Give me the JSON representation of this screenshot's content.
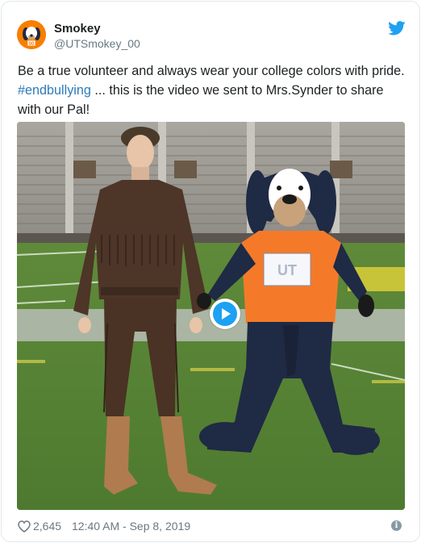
{
  "author": {
    "name": "Smokey",
    "handle": "@UTSmokey_00",
    "avatar_icon": "smokey-dog-icon",
    "avatar_color": "#f77f00"
  },
  "tweet": {
    "line1": "Be a true volunteer and always wear your college colors with pride.",
    "hashtag": "#endbullying",
    "line2_rest": " ... this is the video we sent to Mrs.Synder to share",
    "line3": "with our Pal!"
  },
  "media": {
    "type": "video",
    "play_icon": "play-icon",
    "sign_text": "UT"
  },
  "footer": {
    "likes": "2,645",
    "timestamp": "12:40 AM - Sep 8, 2019",
    "info_icon": "i"
  },
  "colors": {
    "twitter_blue": "#1da1f2",
    "hashtag_blue": "#2b7bb9",
    "muted_gray": "#697882",
    "shirt_orange": "#f47a2a"
  }
}
